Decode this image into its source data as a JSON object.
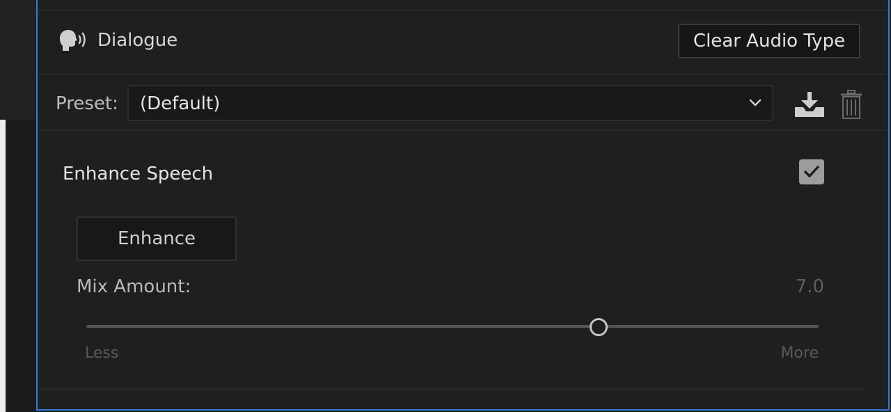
{
  "section": {
    "icon": "speaking-head-icon",
    "title": "Dialogue",
    "clear_button": "Clear Audio Type"
  },
  "preset": {
    "label": "Preset:",
    "value": "(Default)",
    "dropdown_icon": "chevron-down-icon",
    "save_icon": "save-preset-icon",
    "delete_icon": "trash-icon"
  },
  "enhance_speech": {
    "title": "Enhance Speech",
    "checked": true,
    "button": "Enhance",
    "mix_label": "Mix Amount:",
    "mix_value": "7.0",
    "mix_level": 0.7,
    "min_label": "Less",
    "max_label": "More"
  },
  "colors": {
    "accent_border": "#2f7bd6",
    "panel_bg": "#1f1f1f"
  }
}
